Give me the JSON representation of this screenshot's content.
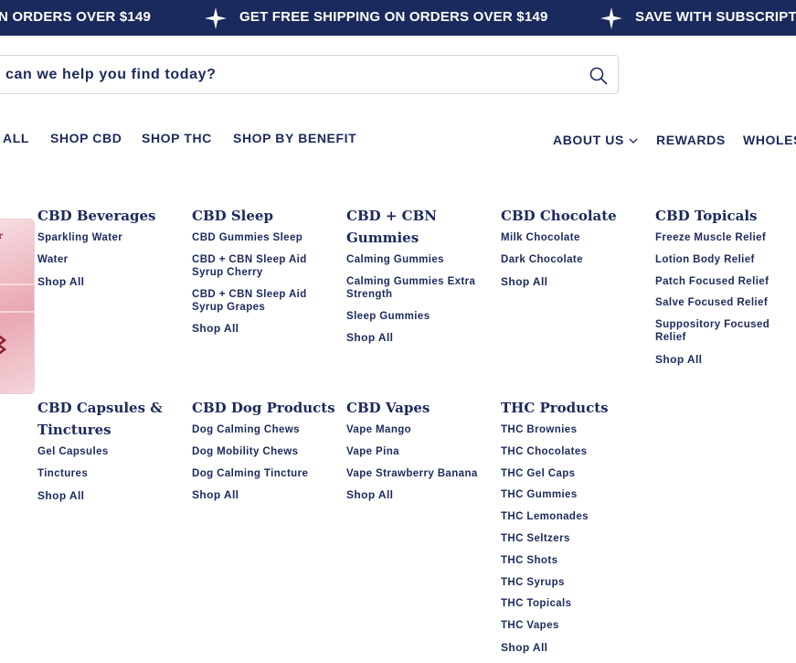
{
  "announcement": {
    "items": [
      "N ORDERS OVER $149",
      "GET FREE SHIPPING ON ORDERS OVER $149",
      "SAVE WITH SUBSCRIPTI"
    ],
    "separator_icon": "sparkle-icon",
    "background": "#1b2a5c",
    "text_color": "#ffffff"
  },
  "search": {
    "placeholder": "can we help you find today?",
    "icon": "search-icon"
  },
  "nav": {
    "left": [
      "ALL",
      "SHOP CBD",
      "SHOP THC",
      "SHOP BY BENEFIT"
    ],
    "about": "ABOUT US",
    "rewards": "REWARDS",
    "wholesale": "WHOLES"
  },
  "promo": {
    "text": "r"
  },
  "menu": {
    "columns": [
      {
        "title": "CBD Beverages",
        "links": [
          "Sparkling Water",
          "Water",
          "Shop All"
        ]
      },
      {
        "title": "CBD Sleep",
        "links": [
          "CBD Gummies Sleep",
          "CBD + CBN Sleep Aid Syrup Cherry",
          "CBD + CBN Sleep Aid Syrup Grapes",
          "Shop All"
        ]
      },
      {
        "title": "CBD + CBN Gummies",
        "links": [
          "Calming Gummies",
          "Calming Gummies Extra Strength",
          "Sleep Gummies",
          "Shop All"
        ]
      },
      {
        "title": "CBD Chocolate",
        "links": [
          "Milk Chocolate",
          "Dark Chocolate",
          "Shop All"
        ]
      },
      {
        "title": "CBD Topicals",
        "links": [
          "Freeze Muscle Relief",
          "Lotion Body Relief",
          "Patch Focused Relief",
          "Salve Focused Relief",
          "Suppository Focused Relief",
          "Shop All"
        ]
      },
      {
        "title": "CBD Capsules & Tinctures",
        "links": [
          "Gel Capsules",
          "Tinctures",
          "Shop All"
        ]
      },
      {
        "title": "CBD Dog Products",
        "links": [
          "Dog Calming Chews",
          "Dog Mobility Chews",
          "Dog Calming Tincture",
          "Shop All"
        ]
      },
      {
        "title": "CBD Vapes",
        "links": [
          "Vape Mango",
          "Vape Pina",
          "Vape Strawberry Banana",
          "Shop All"
        ]
      },
      {
        "title": "THC Products",
        "links": [
          "THC Brownies",
          "THC Chocolates",
          "THC Gel Caps",
          "THC Gummies",
          "THC Lemonades",
          "THC Seltzers",
          "THC Shots",
          "THC Syrups",
          "THC Topicals",
          "THC Vapes",
          "Shop All"
        ]
      }
    ]
  }
}
